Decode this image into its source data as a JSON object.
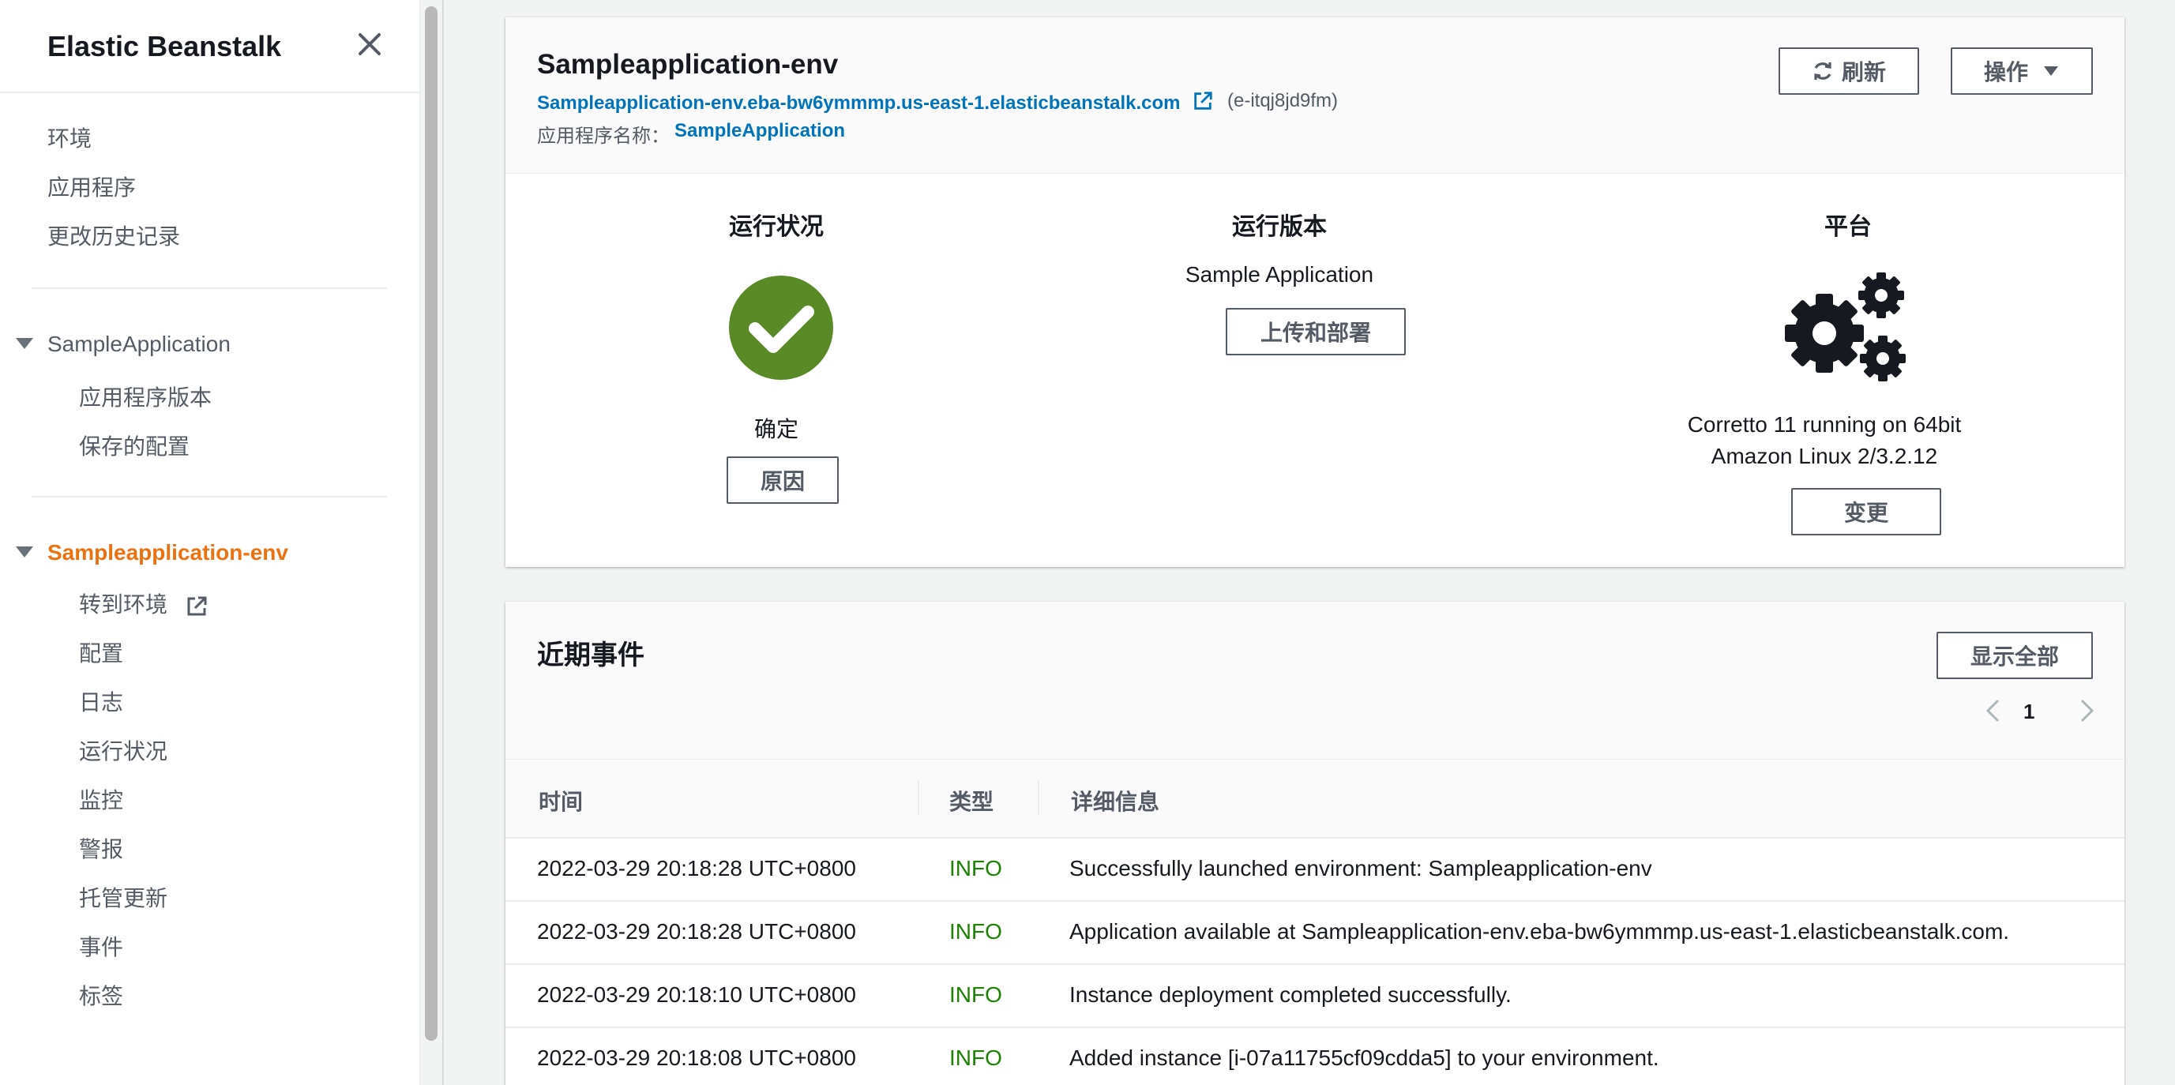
{
  "sidebar": {
    "title": "Elastic Beanstalk",
    "top_links": [
      "环境",
      "应用程序",
      "更改历史记录"
    ],
    "app_section": {
      "label": "SampleApplication",
      "items": [
        "应用程序版本",
        "保存的配置"
      ]
    },
    "env_section": {
      "label": "Sampleapplication-env",
      "items": [
        "转到环境",
        "配置",
        "日志",
        "运行状况",
        "监控",
        "警报",
        "托管更新",
        "事件",
        "标签"
      ]
    }
  },
  "env": {
    "name": "Sampleapplication-env",
    "url": "Sampleapplication-env.eba-bw6ymmmp.us-east-1.elasticbeanstalk.com",
    "id": "(e-itqj8jd9fm)",
    "app_name_label": "应用程序名称：",
    "app_name": "SampleApplication",
    "refresh_label": "刷新",
    "actions_label": "操作",
    "health": {
      "title": "运行状况",
      "status": "确定",
      "cause_button": "原因"
    },
    "version": {
      "title": "运行版本",
      "value": "Sample Application",
      "deploy_button": "上传和部署"
    },
    "platform": {
      "title": "平台",
      "line1": "Corretto 11 running on 64bit",
      "line2": "Amazon Linux 2/3.2.12",
      "change_button": "变更"
    }
  },
  "events": {
    "title": "近期事件",
    "show_all_label": "显示全部",
    "page": "1",
    "columns": [
      "时间",
      "类型",
      "详细信息"
    ],
    "rows": [
      [
        "2022-03-29 20:18:28 UTC+0800",
        "INFO",
        "Successfully launched environment: Sampleapplication-env"
      ],
      [
        "2022-03-29 20:18:28 UTC+0800",
        "INFO",
        "Application available at Sampleapplication-env.eba-bw6ymmmp.us-east-1.elasticbeanstalk.com."
      ],
      [
        "2022-03-29 20:18:10 UTC+0800",
        "INFO",
        "Instance deployment completed successfully."
      ],
      [
        "2022-03-29 20:18:08 UTC+0800",
        "INFO",
        "Added instance [i-07a11755cf09cdda5] to your environment."
      ]
    ]
  },
  "colors": {
    "accent": "#ec7211",
    "link": "#0073bb",
    "ok_green": "#5a8a26",
    "info_green": "#1d8102"
  }
}
